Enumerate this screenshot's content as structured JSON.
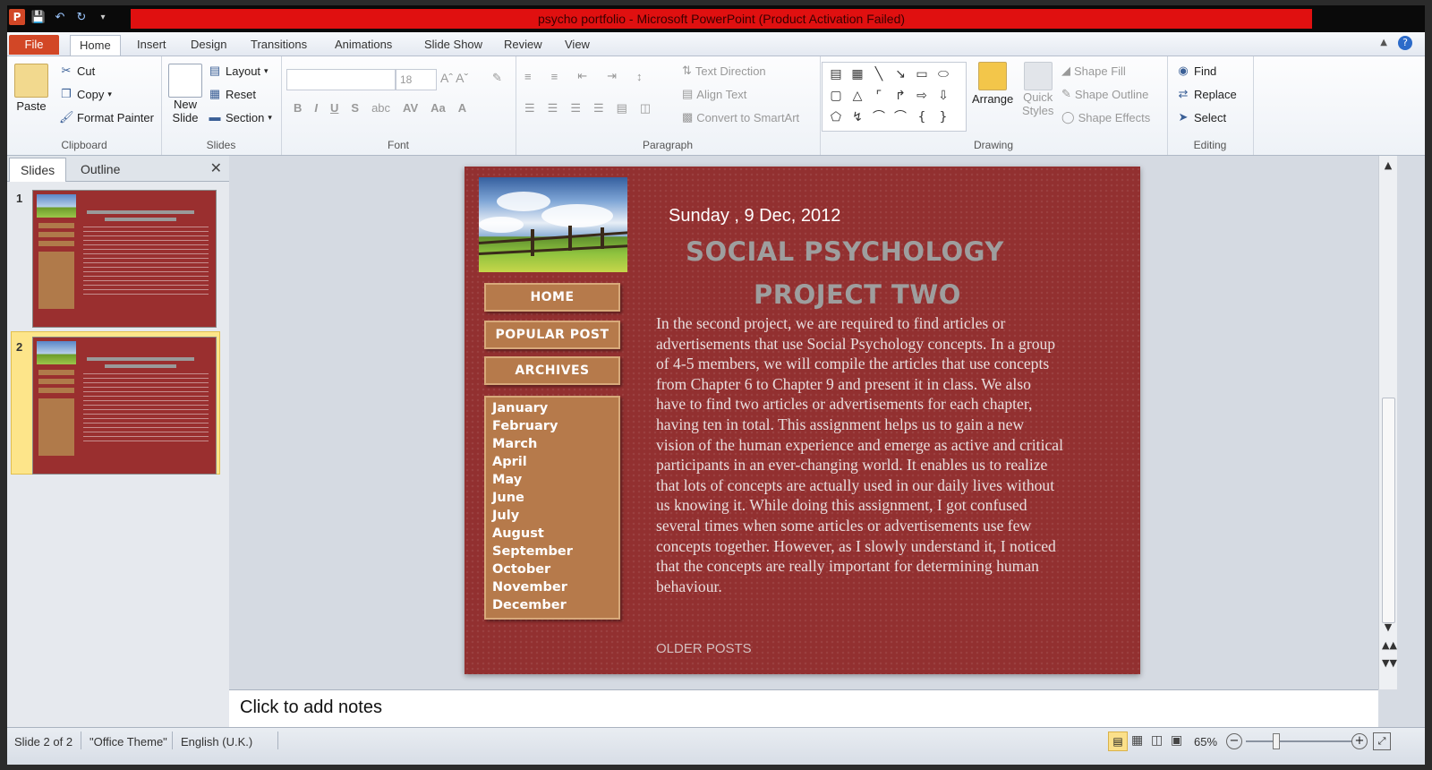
{
  "window": {
    "title": "psycho portfolio  -  Microsoft PowerPoint (Product Activation Failed)",
    "app_icon": "P"
  },
  "ribbon_tabs": [
    "File",
    "Home",
    "Insert",
    "Design",
    "Transitions",
    "Animations",
    "Slide Show",
    "Review",
    "View"
  ],
  "ribbon": {
    "clipboard": {
      "paste": "Paste",
      "cut": "Cut",
      "copy": "Copy",
      "format_painter": "Format Painter",
      "label": "Clipboard"
    },
    "slides": {
      "new_slide_line1": "New",
      "new_slide_line2": "Slide",
      "layout": "Layout",
      "reset": "Reset",
      "section": "Section",
      "label": "Slides"
    },
    "font": {
      "size": "18",
      "label": "Font"
    },
    "paragraph": {
      "text_direction": "Text Direction",
      "align_text": "Align Text",
      "convert": "Convert to SmartArt",
      "label": "Paragraph"
    },
    "drawing": {
      "arrange": "Arrange",
      "quick_styles_line1": "Quick",
      "quick_styles_line2": "Styles",
      "shape_fill": "Shape Fill",
      "shape_outline": "Shape Outline",
      "shape_effects": "Shape Effects",
      "label": "Drawing"
    },
    "editing": {
      "find": "Find",
      "replace": "Replace",
      "select": "Select",
      "label": "Editing"
    }
  },
  "panel": {
    "tabs": [
      "Slides",
      "Outline"
    ],
    "slide_numbers": [
      "1",
      "2"
    ]
  },
  "slide": {
    "date": "Sunday , 9 Dec, 2012",
    "title_line1": "SOCIAL PSYCHOLOGY",
    "title_line2": "PROJECT TWO",
    "nav": [
      "HOME",
      "POPULAR POST",
      "ARCHIVES"
    ],
    "months": [
      "January",
      "February",
      "March",
      "April",
      "May",
      "June",
      "July",
      "August",
      "September",
      "October",
      "November",
      "December"
    ],
    "body": "In the second project, we are required to find articles or advertisements that use Social Psychology concepts. In a group of 4-5 members, we will compile the articles that use concepts from Chapter 6 to Chapter 9 and present it in class. We also have to find two articles or advertisements for each chapter, having ten in total. This assignment helps us to gain a new vision of the human experience and emerge as active and critical participants in an ever-changing world. It enables us to realize that lots of concepts are actually used in our daily lives without us knowing it. While doing this assignment, I got confused several times when some articles or advertisements use few concepts together. However, as I slowly understand it, I noticed that the concepts are really important for determining human behaviour.",
    "older_posts": "OLDER POSTS"
  },
  "notes": {
    "placeholder": "Click to add notes"
  },
  "status": {
    "slide": "Slide 2 of 2",
    "theme": "\"Office Theme\"",
    "language": "English (U.K.)",
    "zoom": "65%"
  },
  "colors": {
    "file_tab": "#d24726",
    "slide_bg": "#923030",
    "nav_bg": "#b67a4b",
    "title_gray": "#9e9e9e",
    "titlebar_red": "#e01010"
  }
}
